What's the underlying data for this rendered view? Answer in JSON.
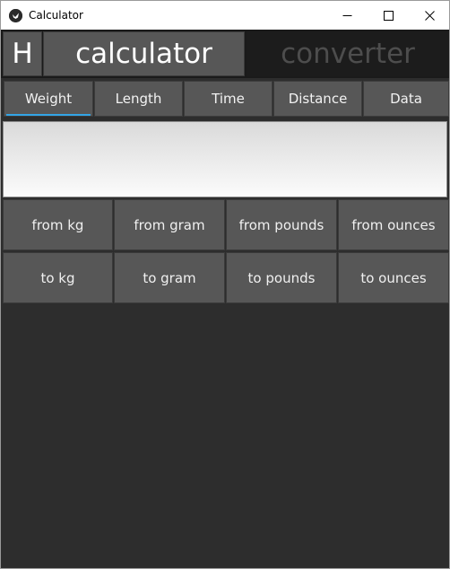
{
  "window": {
    "title": "Calculator",
    "icon": "kivy-app-icon"
  },
  "modes": {
    "history_label": "H",
    "calculator_label": "calculator",
    "converter_label": "converter"
  },
  "tabs": [
    {
      "label": "Weight",
      "active": true
    },
    {
      "label": "Length",
      "active": false
    },
    {
      "label": "Time",
      "active": false
    },
    {
      "label": "Distance",
      "active": false
    },
    {
      "label": "Data",
      "active": false
    }
  ],
  "display": {
    "value": ""
  },
  "buttons": {
    "from_row": [
      "from kg",
      "from gram",
      "from pounds",
      "from ounces"
    ],
    "to_row": [
      "to kg",
      "to gram",
      "to pounds",
      "to ounces"
    ]
  },
  "colors": {
    "button_bg": "#575757",
    "background": "#2d2d2d",
    "active_tab_indicator": "#33a5e6",
    "converter_inactive_text": "#4d4d4d"
  }
}
